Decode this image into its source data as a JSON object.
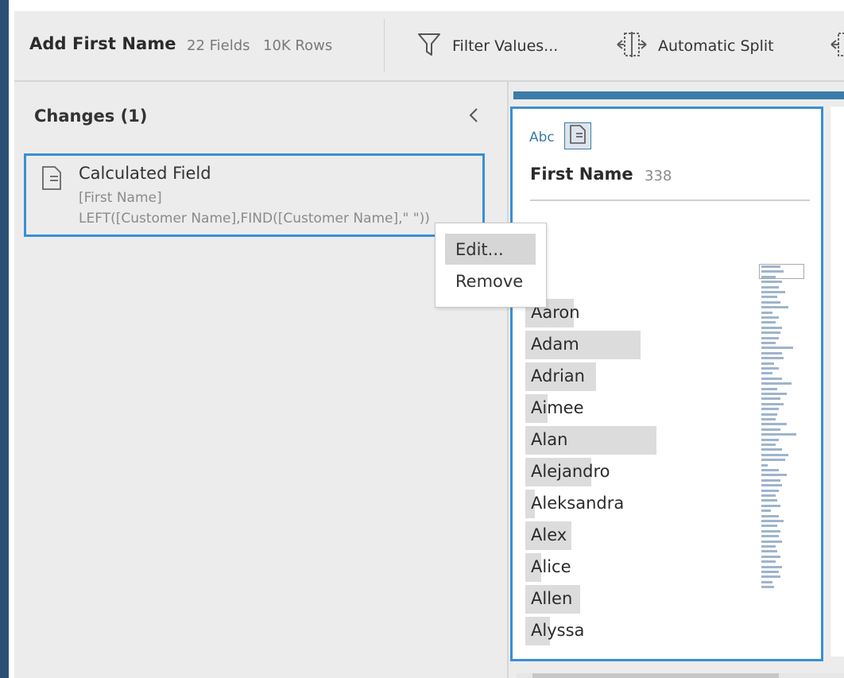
{
  "toolbar": {
    "step_title": "Add First Name",
    "fields": "22 Fields",
    "rows": "10K Rows",
    "filter_label": "Filter Values...",
    "split_label": "Automatic Split"
  },
  "changes": {
    "title": "Changes (1)",
    "card": {
      "title": "Calculated Field",
      "field": "[First Name]",
      "formula": "LEFT([Customer Name],FIND([Customer Name],\" \"))"
    }
  },
  "context_menu": {
    "items": [
      {
        "label": "Edit..."
      },
      {
        "label": "Remove"
      }
    ]
  },
  "profile": {
    "type_label": "Abc",
    "field_name": "First Name",
    "count": "338",
    "values": [
      {
        "label": "Aaron",
        "count_ratio": 0.37
      },
      {
        "label": "Adam",
        "count_ratio": 0.88
      },
      {
        "label": "Adrian",
        "count_ratio": 0.54
      },
      {
        "label": "Aimee",
        "count_ratio": 0.17
      },
      {
        "label": "Alan",
        "count_ratio": 1.0
      },
      {
        "label": "Alejandro",
        "count_ratio": 0.5
      },
      {
        "label": "Aleksandra",
        "count_ratio": 0.07
      },
      {
        "label": "Alex",
        "count_ratio": 0.35
      },
      {
        "label": "Alice",
        "count_ratio": 0.12
      },
      {
        "label": "Allen",
        "count_ratio": 0.42
      },
      {
        "label": "Alyssa",
        "count_ratio": 0.19
      }
    ]
  },
  "colors": {
    "accent": "#3b8fd3",
    "profile_header": "#3c7ca8",
    "pane_bg": "#ececec",
    "sidebar_strip": "#2d4f73",
    "value_bar": "#dcdcdc",
    "mini_bar": "#9fb4cc"
  }
}
